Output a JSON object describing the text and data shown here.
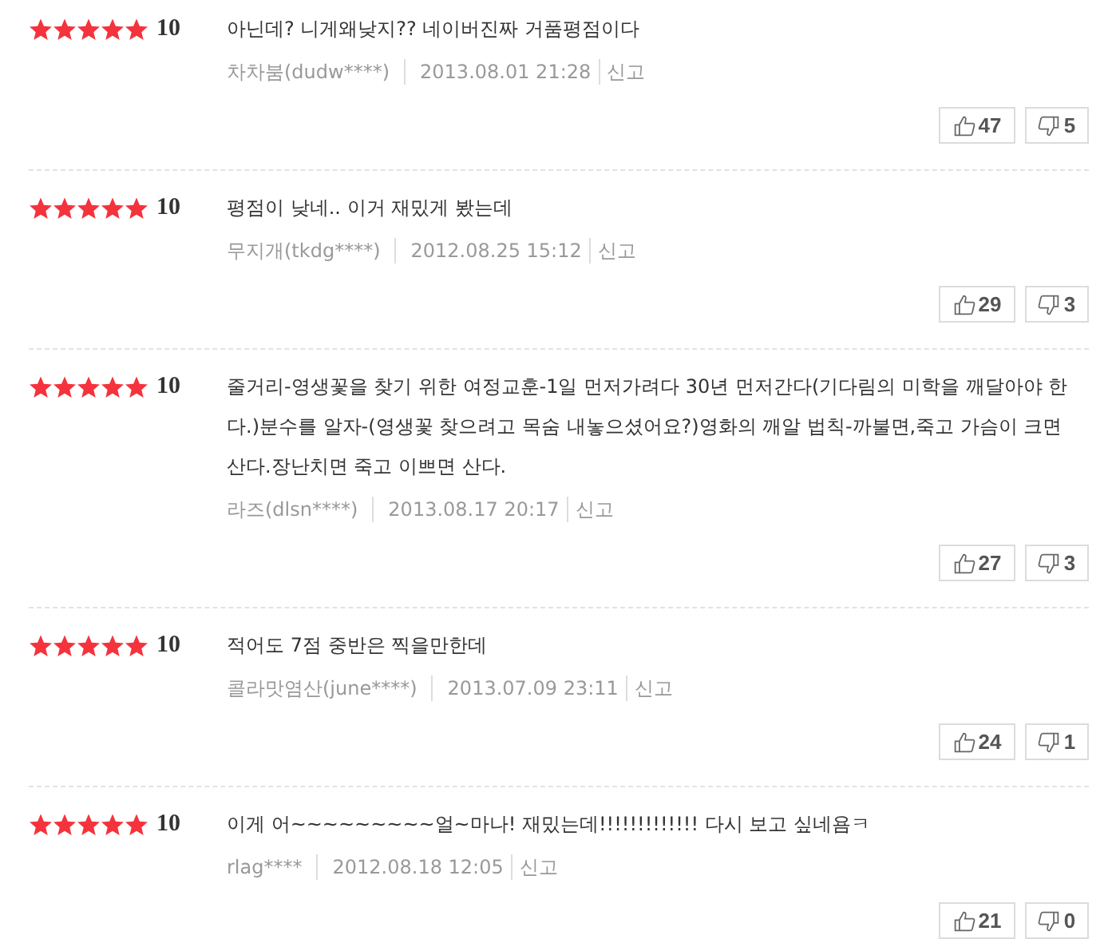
{
  "reviews": [
    {
      "stars": 5,
      "score": "10",
      "text": "아닌데? 니게왜낮지?? 네이버진짜 거품평점이다",
      "author": "차차붐(dudw****)",
      "date": "2013.08.01 21:28",
      "report": "신고",
      "likes": "47",
      "dislikes": "5"
    },
    {
      "stars": 5,
      "score": "10",
      "text": "평점이 낮네.. 이거 재밌게 봤는데",
      "author": "무지개(tkdg****)",
      "date": "2012.08.25 15:12",
      "report": "신고",
      "likes": "29",
      "dislikes": "3"
    },
    {
      "stars": 5,
      "score": "10",
      "text": "줄거리-영생꽃을 찾기 위한 여정교훈-1일 먼저가려다 30년 먼저간다(기다림의 미학을 깨달아야 한다.)분수를 알자-(영생꽃 찾으려고 목숨 내놓으셨어요?)영화의 깨알 법칙-까불면,죽고 가슴이 크면 산다.장난치면 죽고 이쁘면 산다.",
      "author": "라즈(dlsn****)",
      "date": "2013.08.17 20:17",
      "report": "신고",
      "likes": "27",
      "dislikes": "3"
    },
    {
      "stars": 5,
      "score": "10",
      "text": "적어도 7점 중반은 찍을만한데",
      "author": "콜라맛염산(june****)",
      "date": "2013.07.09 23:11",
      "report": "신고",
      "likes": "24",
      "dislikes": "1"
    },
    {
      "stars": 5,
      "score": "10",
      "text": "이게 어~~~~~~~~~얼~마나! 재밌는데!!!!!!!!!!!!! 다시 보고 싶네욤ㅋ",
      "author": "rlag****",
      "date": "2012.08.18 12:05",
      "report": "신고",
      "likes": "21",
      "dislikes": "0"
    }
  ]
}
